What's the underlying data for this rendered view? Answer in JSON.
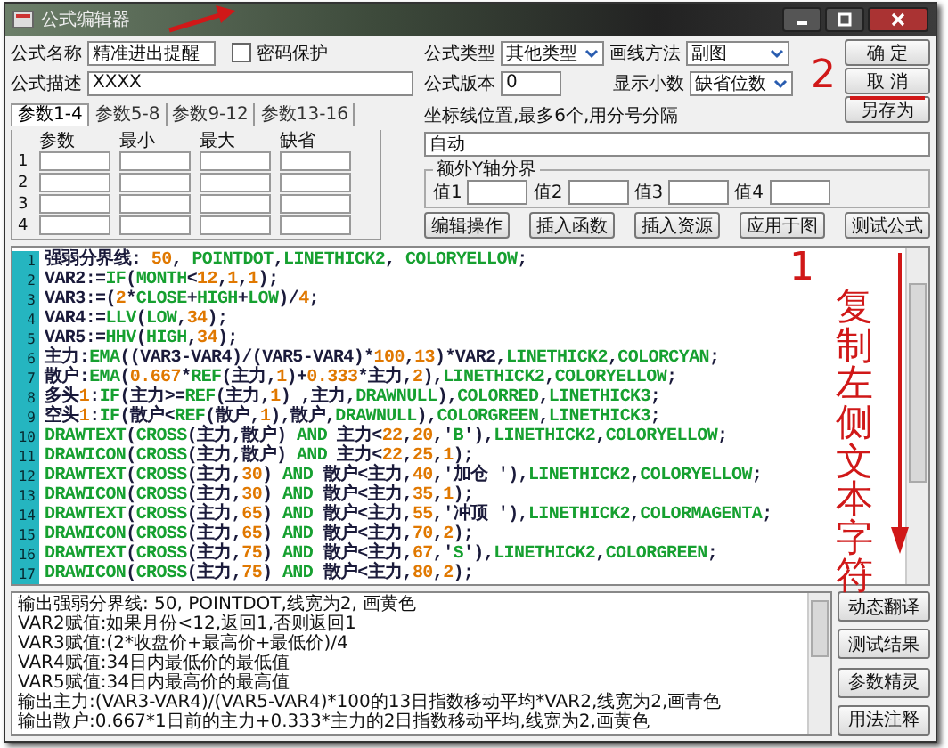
{
  "window": {
    "title": "公式编辑器"
  },
  "formula": {
    "name_label": "公式名称",
    "name": "精准进出提醒",
    "password": {
      "label": "密码保护",
      "checked": false
    },
    "desc_label": "公式描述",
    "desc": "XXXX",
    "type_label": "公式类型",
    "type": "其他类型",
    "draw_label": "画线方法",
    "draw": "副图",
    "version_label": "公式版本",
    "version": "0",
    "decimals_label": "显示小数",
    "decimals": "缺省位数"
  },
  "side_buttons": [
    "确 定",
    "取 消",
    "另存为"
  ],
  "param_tabs": [
    {
      "label": "参数1-4",
      "selected": true
    },
    {
      "label": "参数5-8",
      "selected": false
    },
    {
      "label": "参数9-12",
      "selected": false
    },
    {
      "label": "参数13-16",
      "selected": false
    }
  ],
  "param_table": {
    "columns": [
      "参数",
      "最小",
      "最大",
      "缺省"
    ],
    "rows": [
      "1",
      "2",
      "3",
      "4"
    ]
  },
  "axis": {
    "label": "坐标线位置,最多6个,用分号分隔",
    "value": "自动"
  },
  "extra_y": {
    "title": "额外Y轴分界",
    "fields": [
      "值1",
      "值2",
      "值3",
      "值4"
    ]
  },
  "toolbar": [
    "编辑操作",
    "插入函数",
    "插入资源",
    "应用于图",
    "测试公式"
  ],
  "code_lines": [
    {
      "n": "1",
      "text": "强弱分界线: 50, POINTDOT,LINETHICK2, COLORYELLOW;"
    },
    {
      "n": "2",
      "text": "VAR2:=IF(MONTH<12,1,1);"
    },
    {
      "n": "3",
      "text": "VAR3:=(2*CLOSE+HIGH+LOW)/4;"
    },
    {
      "n": "4",
      "text": "VAR4:=LLV(LOW,34);"
    },
    {
      "n": "5",
      "text": "VAR5:=HHV(HIGH,34);"
    },
    {
      "n": "6",
      "text": "主力:EMA((VAR3-VAR4)/(VAR5-VAR4)*100,13)*VAR2,LINETHICK2,COLORCYAN;"
    },
    {
      "n": "7",
      "text": "散户:EMA(0.667*REF(主力,1)+0.333*主力,2),LINETHICK2,COLORYELLOW;"
    },
    {
      "n": "8",
      "text": "多头1:IF(主力>=REF(主力,1) ,主力,DRAWNULL),COLORRED,LINETHICK3;"
    },
    {
      "n": "9",
      "text": "空头1:IF(散户<REF(散户,1),散户,DRAWNULL),COLORGREEN,LINETHICK3;"
    },
    {
      "n": "10",
      "text": "DRAWTEXT(CROSS(主力,散户) AND 主力<22,20,'B'),LINETHICK2,COLORYELLOW;"
    },
    {
      "n": "11",
      "text": "DRAWICON(CROSS(主力,散户) AND 主力<22,25,1);"
    },
    {
      "n": "12",
      "text": "DRAWTEXT(CROSS(主力,30) AND 散户<主力,40,'加仓 '),LINETHICK2,COLORYELLOW;"
    },
    {
      "n": "13",
      "text": "DRAWICON(CROSS(主力,30) AND 散户<主力,35,1);"
    },
    {
      "n": "14",
      "text": "DRAWTEXT(CROSS(主力,65) AND 散户<主力,55,'冲顶 '),LINETHICK2,COLORMAGENTA;"
    },
    {
      "n": "15",
      "text": "DRAWICON(CROSS(主力,65) AND 散户<主力,70,2);"
    },
    {
      "n": "16",
      "text": "DRAWTEXT(CROSS(主力,75) AND 散户<主力,67,'S'),LINETHICK2,COLORGREEN;"
    },
    {
      "n": "17",
      "text": "DRAWICON(CROSS(主力,75) AND 散户<主力,80,2);"
    }
  ],
  "output_lines": [
    "输出强弱分界线: 50, POINTDOT,线宽为2, 画黄色",
    "VAR2赋值:如果月份<12,返回1,否则返回1",
    "VAR3赋值:(2*收盘价+最高价+最低价)/4",
    "VAR4赋值:34日内最低价的最低值",
    "VAR5赋值:34日内最高价的最高值",
    "输出主力:(VAR3-VAR4)/(VAR5-VAR4)*100的13日指数移动平均*VAR2,线宽为2,画青色",
    "输出散户:0.667*1日前的主力+0.333*主力的2日指数移动平均,线宽为2,画黄色"
  ],
  "output_buttons": [
    "动态翻译",
    "测试结果",
    "参数精灵",
    "用法注释"
  ],
  "annotations": [
    {
      "kind": "number",
      "text": "2"
    },
    {
      "kind": "number",
      "text": "1"
    },
    {
      "kind": "vertical",
      "text": "复制左侧文本字符"
    }
  ]
}
